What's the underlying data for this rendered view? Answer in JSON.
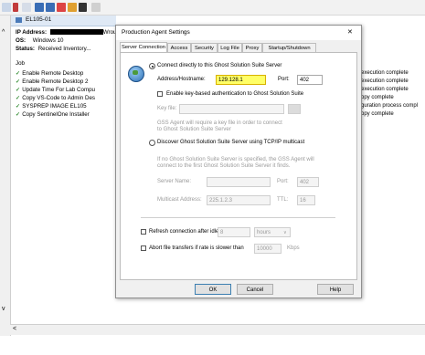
{
  "window": {
    "panel_title": "EL105-01",
    "ip_label": "IP Address:",
    "ip_suffix": "Wrou",
    "os_label": "OS:",
    "os_value": "Windows 10",
    "status_label": "Status:",
    "status_value": "Received Inventory..."
  },
  "jobs": {
    "header": "Job",
    "items": [
      {
        "name": "Enable Remote Desktop",
        "status": "execution complete"
      },
      {
        "name": "Enable Remote Desktop 2",
        "status": "execution complete"
      },
      {
        "name": "Update Time For Lab Compu",
        "status": "execution complete"
      },
      {
        "name": "Copy VS-Code to Admin Des",
        "status": "opy complete"
      },
      {
        "name": "SYSPREP IMAGE EL105",
        "status": "guration process compl"
      },
      {
        "name": "Copy SentinelOne Installer",
        "status": "opy complete"
      }
    ]
  },
  "dialog": {
    "title": "Production Agent Settings",
    "close": "✕",
    "tabs": [
      "Server Connection",
      "Access",
      "Security",
      "Log File",
      "Proxy",
      "Startup/Shutdown"
    ],
    "connect_direct_label": "Connect directly to this Ghost Solution Suite Server",
    "address_label": "Address/Hostname:",
    "address_value": "129.128.1",
    "port_label": "Port:",
    "port_value": "402",
    "keyauth_label": "Enable key-based authentication to Ghost Solution Suite",
    "keyfile_label": "Key file:",
    "keyfile_note_1": "GSS Agent will require a key file in order to connect",
    "keyfile_note_2": "to Ghost Solution Suite Server",
    "discover_label": "Discover Ghost Solution Suite Server using TCP/IP multicast",
    "discover_note_1": "If no Ghost Solution Suite Server is specified, the GSS Agent will",
    "discover_note_2": "connect to the first Ghost Solution Suite Server it finds.",
    "server_name_label": "Server Name:",
    "port2_label": "Port:",
    "port2_value": "402",
    "multicast_label": "Multicast Address:",
    "multicast_value": "225.1.2.3",
    "ttl_label": "TTL:",
    "ttl_value": "16",
    "refresh_label": "Refresh connection after idle",
    "refresh_value": "8",
    "refresh_unit": "hours",
    "abort_label": "Abort file transfers if rate is slower than",
    "abort_value": "10000",
    "abort_unit": "Kbps",
    "ok": "OK",
    "cancel": "Cancel",
    "help": "Help"
  },
  "colors": {
    "address_highlight": "#ffff66",
    "check_green": "#2f8a2f"
  }
}
